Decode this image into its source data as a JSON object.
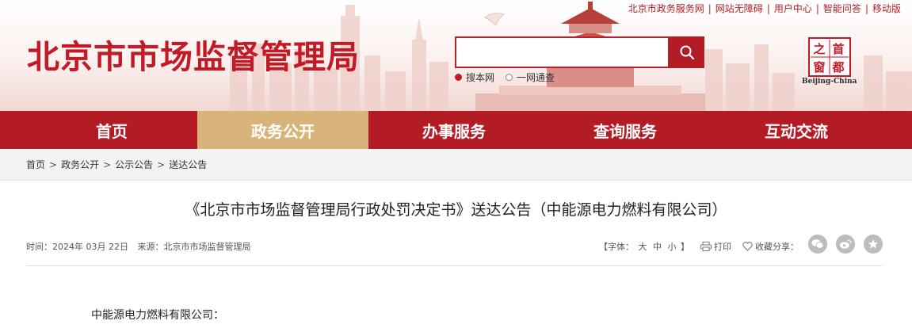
{
  "header": {
    "site_title": "北京市市场监督管理局",
    "top_links": [
      "北京市政务服务网",
      "网站无障碍",
      "用户中心",
      "智能问答",
      "移动版"
    ],
    "search": {
      "placeholder": "",
      "value": ""
    },
    "search_scopes": [
      {
        "label": "搜本网",
        "selected": true
      },
      {
        "label": "一网通查",
        "selected": false
      }
    ],
    "seal": {
      "chars": [
        "首",
        "都",
        "之",
        "窗"
      ],
      "label": "Beijing-China"
    }
  },
  "nav": {
    "items": [
      {
        "label": "首页",
        "active": false
      },
      {
        "label": "政务公开",
        "active": true
      },
      {
        "label": "办事服务",
        "active": false
      },
      {
        "label": "查询服务",
        "active": false
      },
      {
        "label": "互动交流",
        "active": false
      }
    ]
  },
  "breadcrumb": [
    "首页",
    "政务公开",
    "公示公告",
    "送达公告"
  ],
  "article": {
    "title": "《北京市市场监督管理局行政处罚决定书》送达公告（中能源电力燃料有限公司）",
    "time_label": "时间：",
    "date": "2024年 03月 22日",
    "source_label": "来源：",
    "source": "北京市市场监督管理局",
    "font_size_label": "【字体：",
    "font_sizes": [
      "大",
      "中",
      "小"
    ],
    "font_size_end": "】",
    "print_label": "打印",
    "favorite_label": "收藏",
    "share_label": "分享：",
    "share_icons": [
      "wechat-icon",
      "weibo-icon",
      "star-icon"
    ],
    "salutation": "中能源电力燃料有限公司："
  },
  "colors": {
    "brand_red": "#b31b25",
    "title_red": "#c21a26",
    "active_tab": "#d8b47a",
    "crumb_bg": "#f3f3f3"
  }
}
